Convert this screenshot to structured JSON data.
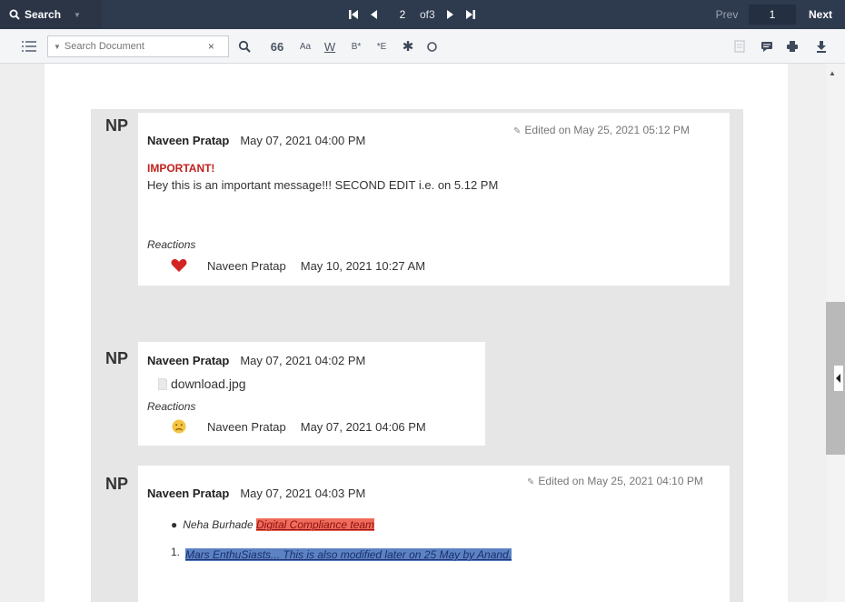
{
  "topbar": {
    "search_label": "Search",
    "page_current": "2",
    "page_total": "of3",
    "prev_label": "Prev",
    "hit_index": "1",
    "next_label": "Next"
  },
  "toolbar": {
    "search_placeholder": "Search Document",
    "clear_label": "×",
    "quote_label": "66",
    "case_label": "Aa",
    "whole_word_label": "W",
    "begins_label": "B*",
    "ends_label": "*E",
    "wildcard_label": "✱"
  },
  "messages": [
    {
      "initials": "NP",
      "author": "Naveen Pratap",
      "time": "May 07, 2021 04:00 PM",
      "edited": "Edited on May 25, 2021 05:12 PM",
      "important": "IMPORTANT!",
      "text": "Hey this is an important message!!! SECOND EDIT i.e. on 5.12 PM",
      "reactions_label": "Reactions",
      "reaction": {
        "emoji": "heart-icon",
        "author": "Naveen Pratap",
        "time": "May 10, 2021 10:27 AM"
      }
    },
    {
      "initials": "NP",
      "author": "Naveen Pratap",
      "time": "May 07, 2021 04:02 PM",
      "attachment": "download.jpg",
      "reactions_label": "Reactions",
      "reaction": {
        "emoji": "sad-face-icon",
        "author": "Naveen Pratap",
        "time": "May 07, 2021 04:06 PM"
      }
    },
    {
      "initials": "NP",
      "author": "Naveen Pratap",
      "time": "May 07, 2021 04:03 PM",
      "edited": "Edited on May 25, 2021 04:10 PM",
      "bullet_name": "Neha Burhade",
      "bullet_highlight": "Digital Compliance team",
      "numbered_index": "1.",
      "numbered_text": "Mars EnthuSiasts... This is also modified later on 25 May by Anand."
    }
  ],
  "colors": {
    "topbar": "#2e3a4d",
    "important": "#c0211c",
    "highlight_red": "#ef6b5b",
    "highlight_blue": "#5c82c4"
  }
}
